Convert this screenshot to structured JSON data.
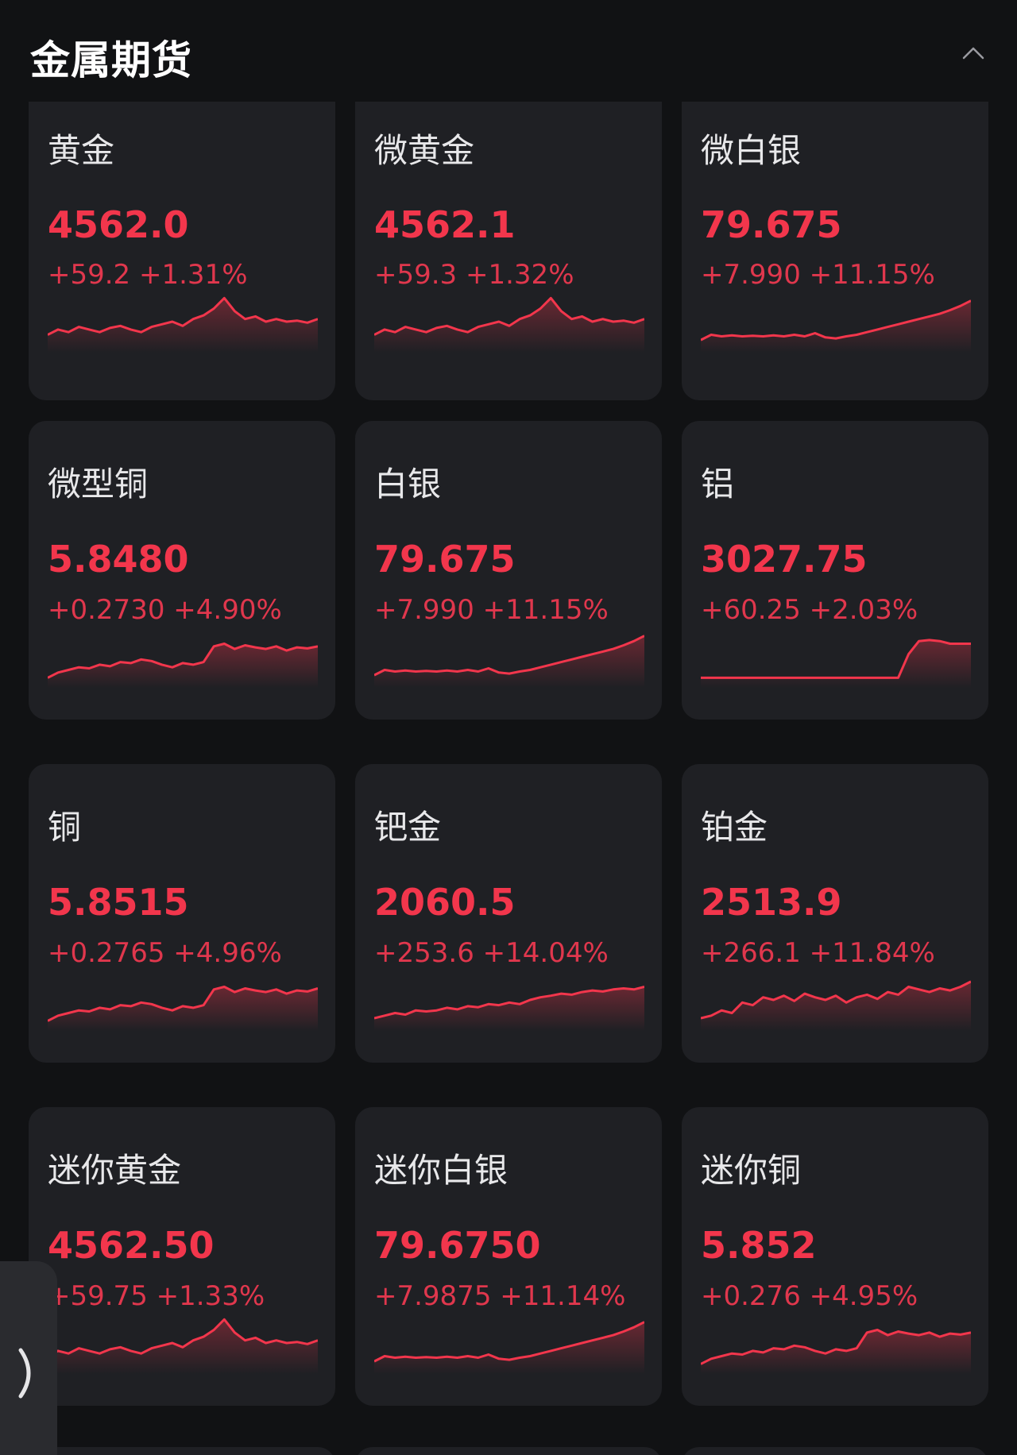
{
  "section": {
    "title": "金属期货",
    "collapse_icon": "chevron-up-icon"
  },
  "colors": {
    "background": "#111214",
    "card": "#1f2024",
    "up": "#f2364c"
  },
  "cards": [
    {
      "name": "黄金",
      "price": "4562.0",
      "change": "+59.2  +1.31%",
      "trend": [
        0.25,
        0.35,
        0.3,
        0.4,
        0.35,
        0.3,
        0.38,
        0.42,
        0.35,
        0.3,
        0.4,
        0.45,
        0.5,
        0.42,
        0.55,
        0.62,
        0.75,
        0.95,
        0.7,
        0.55,
        0.6,
        0.5,
        0.55,
        0.5,
        0.52,
        0.48,
        0.55
      ]
    },
    {
      "name": "微黄金",
      "price": "4562.1",
      "change": "+59.3  +1.32%",
      "trend": [
        0.25,
        0.35,
        0.3,
        0.4,
        0.35,
        0.3,
        0.38,
        0.42,
        0.35,
        0.3,
        0.4,
        0.45,
        0.5,
        0.42,
        0.55,
        0.62,
        0.75,
        0.95,
        0.7,
        0.55,
        0.6,
        0.5,
        0.55,
        0.5,
        0.52,
        0.48,
        0.55
      ]
    },
    {
      "name": "微白银",
      "price": "79.675",
      "change": "+7.990  +11.15%",
      "trend": [
        0.15,
        0.25,
        0.22,
        0.24,
        0.22,
        0.23,
        0.22,
        0.24,
        0.22,
        0.25,
        0.22,
        0.28,
        0.2,
        0.18,
        0.22,
        0.25,
        0.3,
        0.35,
        0.4,
        0.45,
        0.5,
        0.55,
        0.6,
        0.65,
        0.72,
        0.8,
        0.9
      ]
    },
    {
      "name": "微型铜",
      "price": "5.8480",
      "change": "+0.2730  +4.90%",
      "trend": [
        0.1,
        0.2,
        0.25,
        0.3,
        0.28,
        0.35,
        0.32,
        0.4,
        0.38,
        0.45,
        0.42,
        0.35,
        0.3,
        0.38,
        0.35,
        0.4,
        0.7,
        0.75,
        0.65,
        0.72,
        0.68,
        0.65,
        0.7,
        0.62,
        0.68,
        0.66,
        0.7
      ]
    },
    {
      "name": "白银",
      "price": "79.675",
      "change": "+7.990  +11.15%",
      "trend": [
        0.15,
        0.25,
        0.22,
        0.24,
        0.22,
        0.23,
        0.22,
        0.24,
        0.22,
        0.25,
        0.22,
        0.28,
        0.2,
        0.18,
        0.22,
        0.25,
        0.3,
        0.35,
        0.4,
        0.45,
        0.5,
        0.55,
        0.6,
        0.65,
        0.72,
        0.8,
        0.9
      ]
    },
    {
      "name": "铝",
      "price": "3027.75",
      "change": "+60.25  +2.03%",
      "trend": [
        0.1,
        0.1,
        0.1,
        0.1,
        0.1,
        0.1,
        0.1,
        0.1,
        0.1,
        0.1,
        0.1,
        0.1,
        0.1,
        0.1,
        0.1,
        0.1,
        0.1,
        0.1,
        0.1,
        0.1,
        0.55,
        0.8,
        0.82,
        0.8,
        0.75,
        0.75,
        0.75
      ]
    },
    {
      "name": "铜",
      "price": "5.8515",
      "change": "+0.2765  +4.96%",
      "trend": [
        0.1,
        0.2,
        0.25,
        0.3,
        0.28,
        0.35,
        0.32,
        0.4,
        0.38,
        0.45,
        0.42,
        0.35,
        0.3,
        0.38,
        0.35,
        0.4,
        0.7,
        0.75,
        0.65,
        0.72,
        0.68,
        0.65,
        0.7,
        0.62,
        0.68,
        0.66,
        0.72
      ]
    },
    {
      "name": "钯金",
      "price": "2060.5",
      "change": "+253.6  +14.04%",
      "trend": [
        0.15,
        0.2,
        0.25,
        0.22,
        0.3,
        0.28,
        0.3,
        0.35,
        0.32,
        0.38,
        0.36,
        0.42,
        0.4,
        0.45,
        0.42,
        0.5,
        0.55,
        0.58,
        0.62,
        0.6,
        0.65,
        0.68,
        0.66,
        0.7,
        0.72,
        0.7,
        0.75
      ]
    },
    {
      "name": "铂金",
      "price": "2513.9",
      "change": "+266.1  +11.84%",
      "trend": [
        0.15,
        0.2,
        0.3,
        0.25,
        0.45,
        0.4,
        0.55,
        0.5,
        0.58,
        0.48,
        0.62,
        0.55,
        0.5,
        0.58,
        0.45,
        0.55,
        0.6,
        0.52,
        0.65,
        0.6,
        0.75,
        0.7,
        0.65,
        0.72,
        0.68,
        0.75,
        0.85
      ]
    },
    {
      "name": "迷你黄金",
      "price": "4562.50",
      "change": "+59.75  +1.33%",
      "trend": [
        0.25,
        0.35,
        0.3,
        0.4,
        0.35,
        0.3,
        0.38,
        0.42,
        0.35,
        0.3,
        0.4,
        0.45,
        0.5,
        0.42,
        0.55,
        0.62,
        0.75,
        0.95,
        0.7,
        0.55,
        0.6,
        0.5,
        0.55,
        0.5,
        0.52,
        0.48,
        0.55
      ]
    },
    {
      "name": "迷你白银",
      "price": "79.6750",
      "change": "+7.9875  +11.14%",
      "trend": [
        0.15,
        0.25,
        0.22,
        0.24,
        0.22,
        0.23,
        0.22,
        0.24,
        0.22,
        0.25,
        0.22,
        0.28,
        0.2,
        0.18,
        0.22,
        0.25,
        0.3,
        0.35,
        0.4,
        0.45,
        0.5,
        0.55,
        0.6,
        0.65,
        0.72,
        0.8,
        0.9
      ]
    },
    {
      "name": "迷你铜",
      "price": "5.852",
      "change": "+0.276  +4.95%",
      "trend": [
        0.1,
        0.2,
        0.25,
        0.3,
        0.28,
        0.35,
        0.32,
        0.4,
        0.38,
        0.45,
        0.42,
        0.35,
        0.3,
        0.38,
        0.35,
        0.4,
        0.7,
        0.75,
        0.65,
        0.72,
        0.68,
        0.65,
        0.7,
        0.62,
        0.68,
        0.66,
        0.7
      ]
    }
  ],
  "side_tab": {
    "icon": "chevron-right-icon"
  }
}
